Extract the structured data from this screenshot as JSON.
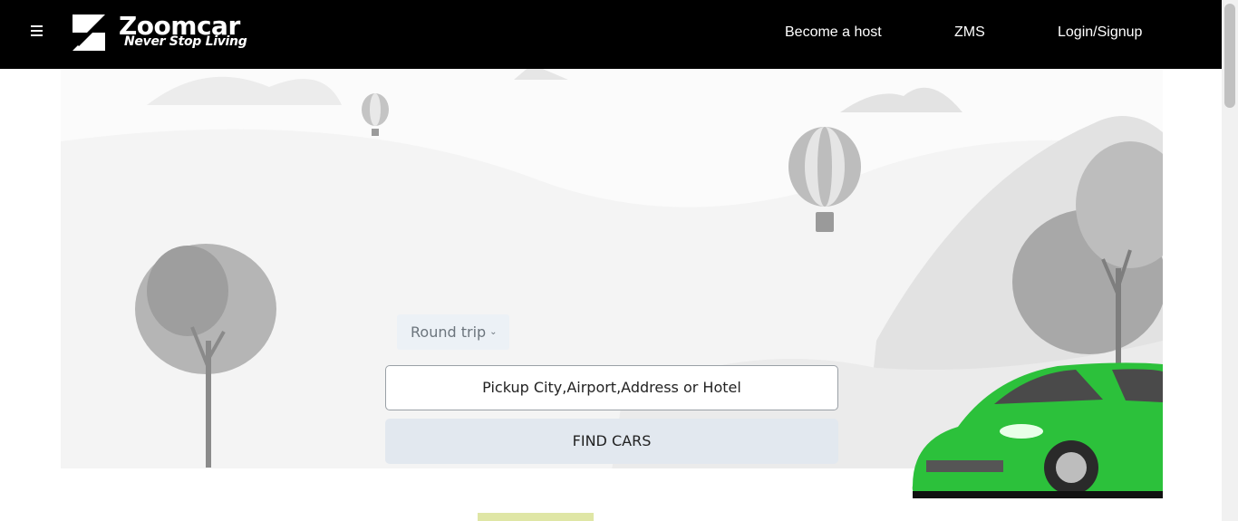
{
  "header": {
    "brand": "Zoomcar",
    "tagline": "Never Stop Living",
    "nav": [
      "Become a host",
      "ZMS",
      "Login/Signup"
    ]
  },
  "search": {
    "trip_type": "Round trip",
    "pickup_placeholder": "Pickup City,Airport,Address or Hotel",
    "find_button": "FIND CARS"
  },
  "colors": {
    "header_bg": "#000000",
    "car": "#2cc13b",
    "button_bg": "#e2e8ef"
  }
}
